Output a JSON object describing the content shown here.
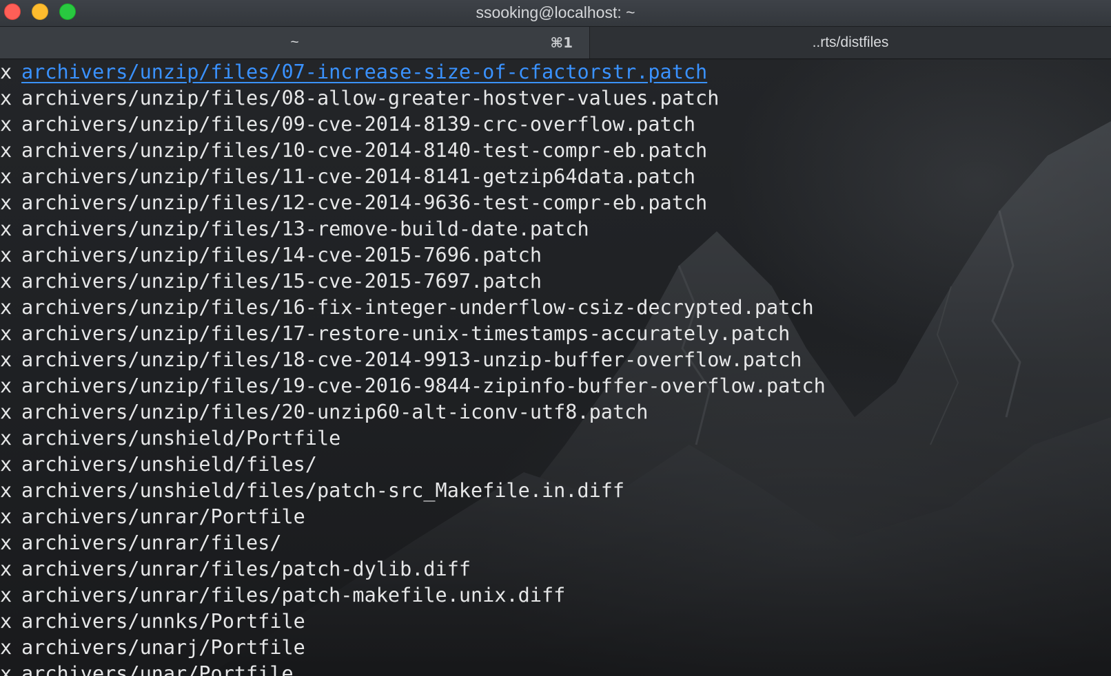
{
  "window": {
    "title": "ssooking@localhost: ~"
  },
  "tabs": [
    {
      "label": "~",
      "shortcut": "⌘1",
      "active": true
    },
    {
      "label": "..rts/distfiles",
      "active": false
    }
  ],
  "colors": {
    "link": "#3a92ff",
    "text": "#e6e7e8",
    "close_button": "#fe5f57",
    "minimize_button": "#febc2e",
    "zoom_button": "#29c840"
  },
  "terminal": {
    "lines": [
      {
        "prefix": "x",
        "text": "archivers/unzip/files/07-increase-size-of-cfactorstr.patch",
        "highlighted": true
      },
      {
        "prefix": "x",
        "text": "archivers/unzip/files/08-allow-greater-hostver-values.patch"
      },
      {
        "prefix": "x",
        "text": "archivers/unzip/files/09-cve-2014-8139-crc-overflow.patch"
      },
      {
        "prefix": "x",
        "text": "archivers/unzip/files/10-cve-2014-8140-test-compr-eb.patch"
      },
      {
        "prefix": "x",
        "text": "archivers/unzip/files/11-cve-2014-8141-getzip64data.patch"
      },
      {
        "prefix": "x",
        "text": "archivers/unzip/files/12-cve-2014-9636-test-compr-eb.patch"
      },
      {
        "prefix": "x",
        "text": "archivers/unzip/files/13-remove-build-date.patch"
      },
      {
        "prefix": "x",
        "text": "archivers/unzip/files/14-cve-2015-7696.patch"
      },
      {
        "prefix": "x",
        "text": "archivers/unzip/files/15-cve-2015-7697.patch"
      },
      {
        "prefix": "x",
        "text": "archivers/unzip/files/16-fix-integer-underflow-csiz-decrypted.patch"
      },
      {
        "prefix": "x",
        "text": "archivers/unzip/files/17-restore-unix-timestamps-accurately.patch"
      },
      {
        "prefix": "x",
        "text": "archivers/unzip/files/18-cve-2014-9913-unzip-buffer-overflow.patch"
      },
      {
        "prefix": "x",
        "text": "archivers/unzip/files/19-cve-2016-9844-zipinfo-buffer-overflow.patch"
      },
      {
        "prefix": "x",
        "text": "archivers/unzip/files/20-unzip60-alt-iconv-utf8.patch"
      },
      {
        "prefix": "x",
        "text": "archivers/unshield/Portfile"
      },
      {
        "prefix": "x",
        "text": "archivers/unshield/files/"
      },
      {
        "prefix": "x",
        "text": "archivers/unshield/files/patch-src_Makefile.in.diff"
      },
      {
        "prefix": "x",
        "text": "archivers/unrar/Portfile"
      },
      {
        "prefix": "x",
        "text": "archivers/unrar/files/"
      },
      {
        "prefix": "x",
        "text": "archivers/unrar/files/patch-dylib.diff"
      },
      {
        "prefix": "x",
        "text": "archivers/unrar/files/patch-makefile.unix.diff"
      },
      {
        "prefix": "x",
        "text": "archivers/unnks/Portfile"
      },
      {
        "prefix": "x",
        "text": "archivers/unarj/Portfile"
      },
      {
        "prefix": "x",
        "text": "archivers/unar/Portfile"
      }
    ]
  }
}
